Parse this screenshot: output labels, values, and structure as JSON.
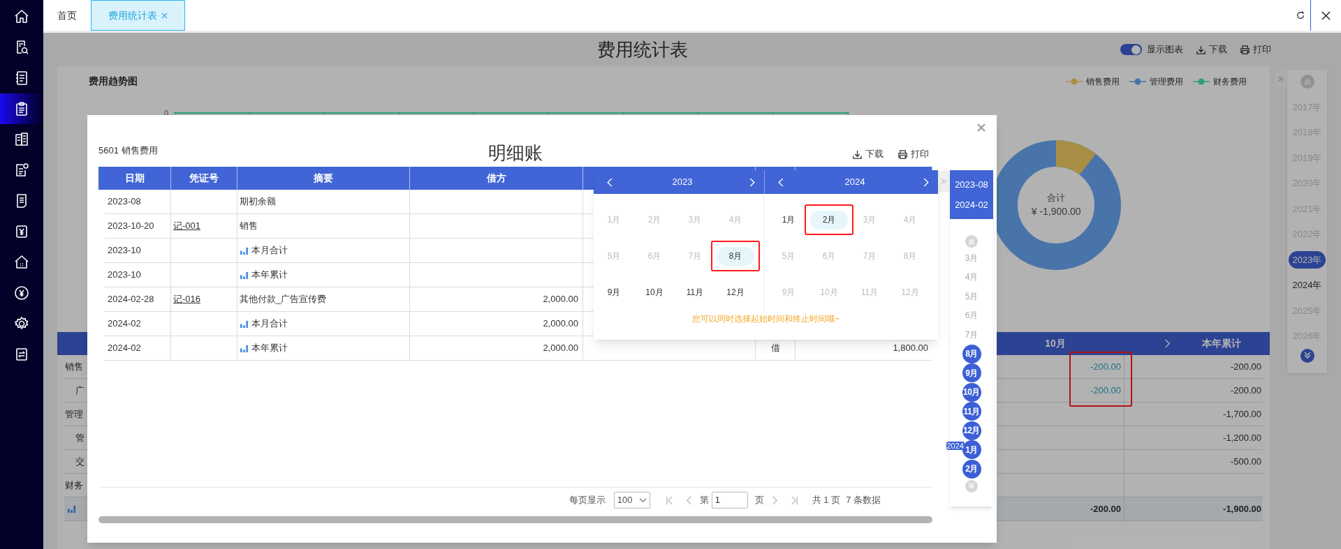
{
  "sidebar": [
    {
      "kind": "home",
      "selected": false
    },
    {
      "kind": "doc-search",
      "selected": false
    },
    {
      "kind": "notebook",
      "selected": false
    },
    {
      "kind": "clipboard",
      "selected": true
    },
    {
      "kind": "building",
      "selected": false
    },
    {
      "kind": "doc-coin",
      "selected": false
    },
    {
      "kind": "doc-lines",
      "selected": false
    },
    {
      "kind": "yen-doc",
      "selected": false
    },
    {
      "kind": "house",
      "selected": false
    },
    {
      "kind": "yen-circle",
      "selected": false
    },
    {
      "kind": "gear",
      "selected": false
    },
    {
      "kind": "swap",
      "selected": false
    }
  ],
  "tabs": [
    {
      "label": "首页",
      "selected": false,
      "closable": false
    },
    {
      "label": "费用统计表",
      "selected": true,
      "closable": true
    }
  ],
  "page": {
    "title": "费用统计表",
    "chart_toggle": {
      "label": "显示图表",
      "on": true
    },
    "actions": [
      {
        "kind": "download",
        "label": "下载"
      },
      {
        "kind": "print",
        "label": "打印"
      }
    ],
    "trend_chart": {
      "title": "费用趋势图",
      "axis_label": "0",
      "legend": [
        {
          "name": "销售费用",
          "color": "#aa8f45"
        },
        {
          "name": "管理费用",
          "color": "#4874ab"
        },
        {
          "name": "财务费用",
          "color": "#2a9e7f"
        }
      ]
    },
    "donut": {
      "label": "合计",
      "total": "¥ -1,900.00"
    },
    "summary_table": {
      "columns": [
        {
          "label": "10月",
          "highlighted": true
        },
        {
          "label": "本年累计"
        }
      ],
      "rows": [
        {
          "label": "销售",
          "month": "-200.00",
          "ytd": "-200.00",
          "linked": true,
          "children": [
            {
              "label": "广",
              "month": "-200.00",
              "ytd": "-200.00",
              "linked": true
            }
          ]
        },
        {
          "label": "管理",
          "ytd": "-1,700.00",
          "children": [
            {
              "label": "管",
              "ytd": "-1,200.00"
            },
            {
              "label": "交",
              "ytd": "-500.00"
            }
          ]
        },
        {
          "label": "财务"
        }
      ],
      "total": {
        "month": "-200.00",
        "ytd": "-1,900.00"
      }
    },
    "year_picker": [
      {
        "label": "2017年",
        "selected": false,
        "disabled": true
      },
      {
        "label": "2018年",
        "selected": false,
        "disabled": true
      },
      {
        "label": "2019年",
        "selected": false,
        "disabled": true
      },
      {
        "label": "2020年",
        "selected": false,
        "disabled": true
      },
      {
        "label": "2021年",
        "selected": false,
        "disabled": true
      },
      {
        "label": "2022年",
        "selected": false,
        "disabled": true
      },
      {
        "label": "2023年",
        "selected": true,
        "disabled": false
      },
      {
        "label": "2024年",
        "selected": false,
        "disabled": false
      },
      {
        "label": "2025年",
        "selected": false,
        "disabled": true
      },
      {
        "label": "2026年",
        "selected": false,
        "disabled": true
      }
    ]
  },
  "modal": {
    "account": "5601 销售费用",
    "title": "明细账",
    "actions": [
      {
        "kind": "download",
        "label": "下载"
      },
      {
        "kind": "print",
        "label": "打印"
      }
    ],
    "columns": [
      "日期",
      "凭证号",
      "摘要",
      "借方"
    ],
    "rows": [
      {
        "date": "2023-08",
        "summary": "期初余额",
        "kind": "entry"
      },
      {
        "date": "2023-10-20",
        "voucher": "记-001",
        "summary": "销售",
        "kind": "entry"
      },
      {
        "date": "2023-10",
        "summary": "本月合计",
        "kind": "subtotal"
      },
      {
        "date": "2023-10",
        "summary": "本年累计",
        "kind": "subtotal"
      },
      {
        "date": "2024-02-28",
        "voucher": "记-016",
        "summary": "其他付款_广告宣传费",
        "debit": "2,000.00",
        "kind": "entry"
      },
      {
        "date": "2024-02",
        "summary": "本月合计",
        "debit": "2,000.00",
        "kind": "subtotal"
      },
      {
        "date": "2024-02",
        "summary": "本年累计",
        "debit": "2,000.00",
        "direction": "借",
        "balance": "1,800.00",
        "kind": "subtotal"
      }
    ],
    "pagination": {
      "per_page_label": "每页显示",
      "per_page": "100",
      "page_prefix": "第",
      "page": "1",
      "page_suffix": "页",
      "total_pages": "共 1 页",
      "total_rows": "7 条数据"
    },
    "calendar": {
      "panels": [
        {
          "year": "2023",
          "months": [
            {
              "label": "1月",
              "disabled": true,
              "selected": false,
              "highlighted": false
            },
            {
              "label": "2月",
              "disabled": true,
              "selected": false,
              "highlighted": false
            },
            {
              "label": "3月",
              "disabled": true,
              "selected": false,
              "highlighted": false
            },
            {
              "label": "4月",
              "disabled": true,
              "selected": false,
              "highlighted": false
            },
            {
              "label": "5月",
              "disabled": true,
              "selected": false,
              "highlighted": false
            },
            {
              "label": "6月",
              "disabled": true,
              "selected": false,
              "highlighted": false
            },
            {
              "label": "7月",
              "disabled": true,
              "selected": false,
              "highlighted": false
            },
            {
              "label": "8月",
              "disabled": false,
              "selected": true,
              "highlighted": true
            },
            {
              "label": "9月",
              "disabled": false,
              "selected": false,
              "highlighted": false
            },
            {
              "label": "10月",
              "disabled": false,
              "selected": false,
              "highlighted": false
            },
            {
              "label": "11月",
              "disabled": false,
              "selected": false,
              "highlighted": false
            },
            {
              "label": "12月",
              "disabled": false,
              "selected": false,
              "highlighted": false
            }
          ]
        },
        {
          "year": "2024",
          "months": [
            {
              "label": "1月",
              "disabled": false,
              "selected": false,
              "highlighted": false
            },
            {
              "label": "2月",
              "disabled": false,
              "selected": true,
              "highlighted": true
            },
            {
              "label": "3月",
              "disabled": true,
              "selected": false,
              "highlighted": false
            },
            {
              "label": "4月",
              "disabled": true,
              "selected": false,
              "highlighted": false
            },
            {
              "label": "5月",
              "disabled": true,
              "selected": false,
              "highlighted": false
            },
            {
              "label": "6月",
              "disabled": true,
              "selected": false,
              "highlighted": false
            },
            {
              "label": "7月",
              "disabled": true,
              "selected": false,
              "highlighted": false
            },
            {
              "label": "8月",
              "disabled": true,
              "selected": false,
              "highlighted": false
            },
            {
              "label": "9月",
              "disabled": true,
              "selected": false,
              "highlighted": false
            },
            {
              "label": "10月",
              "disabled": true,
              "selected": false,
              "highlighted": false
            },
            {
              "label": "11月",
              "disabled": true,
              "selected": false,
              "highlighted": false
            },
            {
              "label": "12月",
              "disabled": true,
              "selected": false,
              "highlighted": false
            }
          ]
        }
      ],
      "tip": "您可以同时选择起始时间和终止时间哦~"
    },
    "range": {
      "start": "2023-08",
      "end": "2024-02",
      "months": [
        {
          "label": "3月",
          "in_range": false
        },
        {
          "label": "4月",
          "in_range": false
        },
        {
          "label": "5月",
          "in_range": false
        },
        {
          "label": "6月",
          "in_range": false
        },
        {
          "label": "7月",
          "in_range": false
        },
        {
          "label": "8月",
          "in_range": true
        },
        {
          "label": "9月",
          "in_range": true
        },
        {
          "label": "10月",
          "in_range": true
        },
        {
          "label": "11月",
          "in_range": true
        },
        {
          "label": "12月",
          "in_range": true
        },
        {
          "label": "1月",
          "in_range": true,
          "year_tag": "2024"
        },
        {
          "label": "2月",
          "in_range": true
        }
      ]
    }
  }
}
